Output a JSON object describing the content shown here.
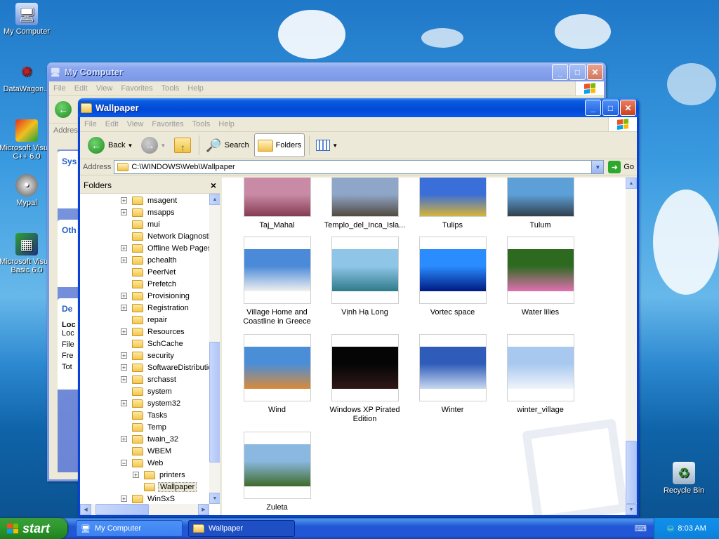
{
  "desktop": {
    "icons": [
      {
        "label": "My Computer",
        "icon": "computer-icon"
      },
      {
        "label": "DataWagon...",
        "icon": "datawagon-icon"
      },
      {
        "label": "Microsoft Visual C++ 6.0",
        "icon": "visual-cpp-icon"
      },
      {
        "label": "Mypal",
        "icon": "mypal-icon"
      },
      {
        "label": "Microsoft Visual Basic 6.0",
        "icon": "visual-basic-icon"
      },
      {
        "label": "Recycle Bin",
        "icon": "recycle-bin-icon"
      }
    ]
  },
  "back_window": {
    "title": "My Computer",
    "menu": [
      "File",
      "Edit",
      "View",
      "Favorites",
      "Tools",
      "Help"
    ],
    "address_label": "Addres",
    "side_headings": [
      "Sys",
      "Oth",
      "De"
    ],
    "details_lines": [
      "Loc",
      "Loc",
      "File",
      "Fre",
      "Tot"
    ]
  },
  "front_window": {
    "title": "Wallpaper",
    "menu": [
      "File",
      "Edit",
      "View",
      "Favorites",
      "Tools",
      "Help"
    ],
    "toolbar": {
      "back": "Back",
      "search": "Search",
      "folders": "Folders"
    },
    "address": {
      "label": "Address",
      "value": "C:\\WINDOWS\\Web\\Wallpaper",
      "go": "Go"
    },
    "folders_pane": {
      "title": "Folders",
      "close": "×",
      "items": [
        {
          "label": "msagent",
          "expander": "+",
          "indent": 0
        },
        {
          "label": "msapps",
          "expander": "+",
          "indent": 0
        },
        {
          "label": "mui",
          "expander": "",
          "indent": 0
        },
        {
          "label": "Network Diagnostic",
          "expander": "",
          "indent": 0
        },
        {
          "label": "Offline Web Pages",
          "expander": "+",
          "indent": 0
        },
        {
          "label": "pchealth",
          "expander": "+",
          "indent": 0
        },
        {
          "label": "PeerNet",
          "expander": "",
          "indent": 0
        },
        {
          "label": "Prefetch",
          "expander": "",
          "indent": 0
        },
        {
          "label": "Provisioning",
          "expander": "+",
          "indent": 0
        },
        {
          "label": "Registration",
          "expander": "+",
          "indent": 0
        },
        {
          "label": "repair",
          "expander": "",
          "indent": 0
        },
        {
          "label": "Resources",
          "expander": "+",
          "indent": 0
        },
        {
          "label": "SchCache",
          "expander": "",
          "indent": 0
        },
        {
          "label": "security",
          "expander": "+",
          "indent": 0
        },
        {
          "label": "SoftwareDistributio",
          "expander": "+",
          "indent": 0
        },
        {
          "label": "srchasst",
          "expander": "+",
          "indent": 0
        },
        {
          "label": "system",
          "expander": "",
          "indent": 0
        },
        {
          "label": "system32",
          "expander": "+",
          "indent": 0
        },
        {
          "label": "Tasks",
          "expander": "",
          "indent": 0
        },
        {
          "label": "Temp",
          "expander": "",
          "indent": 0
        },
        {
          "label": "twain_32",
          "expander": "+",
          "indent": 0
        },
        {
          "label": "WBEM",
          "expander": "",
          "indent": 0
        },
        {
          "label": "Web",
          "expander": "−",
          "indent": 0
        },
        {
          "label": "printers",
          "expander": "+",
          "indent": 1
        },
        {
          "label": "Wallpaper",
          "expander": "",
          "indent": 1,
          "selected": true
        },
        {
          "label": "WinSxS",
          "expander": "+",
          "indent": 0
        }
      ]
    },
    "thumbnails": [
      {
        "caption": "Taj_Mahal",
        "colors": [
          "#c98aa5",
          "#7a2f44"
        ]
      },
      {
        "caption": "Templo_del_Inca_Isla...",
        "colors": [
          "#8ea6c8",
          "#4a3a2a"
        ]
      },
      {
        "caption": "Tulips",
        "colors": [
          "#3a6ed8",
          "#f0c020"
        ]
      },
      {
        "caption": "Tulum",
        "colors": [
          "#5da0d8",
          "#2a3038"
        ]
      },
      {
        "caption": "Village Home and Coastline in Greece",
        "colors": [
          "#4a8ad8",
          "#f0f0f0"
        ]
      },
      {
        "caption": "Vịnh Hạ Long",
        "colors": [
          "#8fc6e8",
          "#2e7a8a"
        ]
      },
      {
        "caption": "Vortec space",
        "colors": [
          "#2a8cff",
          "#001a80"
        ]
      },
      {
        "caption": "Water lilies",
        "colors": [
          "#2d6a20",
          "#e070b0"
        ]
      },
      {
        "caption": "Wind",
        "colors": [
          "#4a8ed8",
          "#d98a3a"
        ]
      },
      {
        "caption": "Windows XP Pirated Edition",
        "colors": [
          "#050505",
          "#301818"
        ]
      },
      {
        "caption": "Winter",
        "colors": [
          "#2e5cb8",
          "#c8d8f0"
        ]
      },
      {
        "caption": "winter_village",
        "colors": [
          "#a8c8f0",
          "#f0f4fa"
        ]
      },
      {
        "caption": "Zuleta",
        "colors": [
          "#8ab8e0",
          "#3f6a2a"
        ]
      }
    ]
  },
  "taskbar": {
    "start": "start",
    "tasks": [
      {
        "label": "My Computer"
      },
      {
        "label": "Wallpaper"
      }
    ],
    "clock": "8:03 AM"
  }
}
